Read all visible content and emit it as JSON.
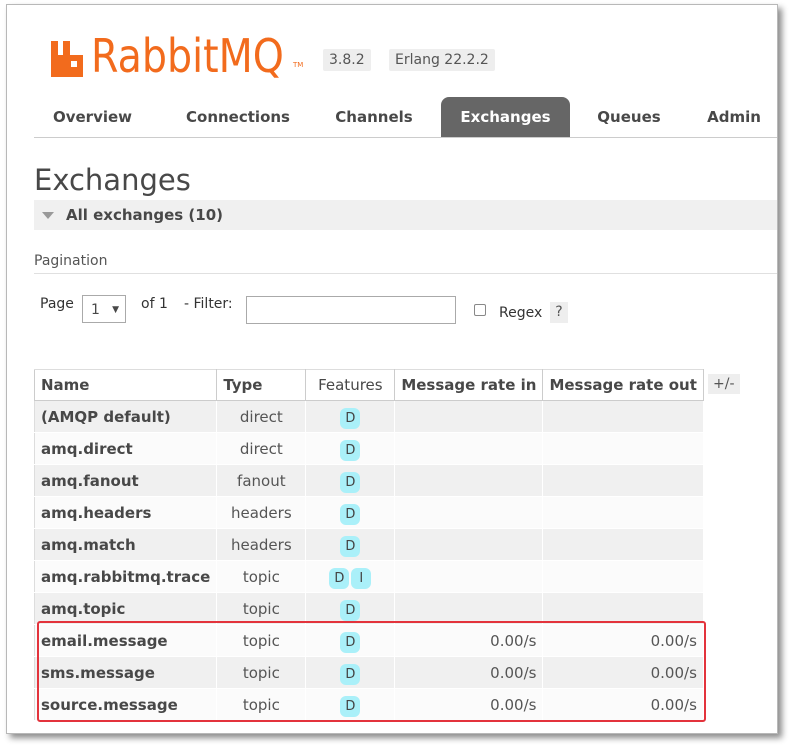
{
  "app": {
    "logo_text": "RabbitMQ",
    "logo_tm": "TM",
    "version": "3.8.2",
    "erlang": "Erlang 22.2.2",
    "brand_color": "#f26b1d"
  },
  "tabs": [
    {
      "label": "Overview"
    },
    {
      "label": "Connections"
    },
    {
      "label": "Channels"
    },
    {
      "label": "Exchanges",
      "active": true
    },
    {
      "label": "Queues"
    },
    {
      "label": "Admin"
    }
  ],
  "page_title": "Exchanges",
  "section_title": "All exchanges (10)",
  "pagination": {
    "label": "Pagination",
    "page_label": "Page",
    "page_value": "1",
    "of_label": "of 1",
    "filter_label": "- Filter:",
    "filter_value": "",
    "regex_label": "Regex",
    "help": "?"
  },
  "table": {
    "columns": [
      "Name",
      "Type",
      "Features",
      "Message rate in",
      "Message rate out"
    ],
    "toggle_columns": "+/-",
    "rows": [
      {
        "name": "(AMQP default)",
        "type": "direct",
        "features": [
          "D"
        ],
        "rate_in": "",
        "rate_out": ""
      },
      {
        "name": "amq.direct",
        "type": "direct",
        "features": [
          "D"
        ],
        "rate_in": "",
        "rate_out": ""
      },
      {
        "name": "amq.fanout",
        "type": "fanout",
        "features": [
          "D"
        ],
        "rate_in": "",
        "rate_out": ""
      },
      {
        "name": "amq.headers",
        "type": "headers",
        "features": [
          "D"
        ],
        "rate_in": "",
        "rate_out": ""
      },
      {
        "name": "amq.match",
        "type": "headers",
        "features": [
          "D"
        ],
        "rate_in": "",
        "rate_out": ""
      },
      {
        "name": "amq.rabbitmq.trace",
        "type": "topic",
        "features": [
          "D",
          "I"
        ],
        "rate_in": "",
        "rate_out": ""
      },
      {
        "name": "amq.topic",
        "type": "topic",
        "features": [
          "D"
        ],
        "rate_in": "",
        "rate_out": ""
      },
      {
        "name": "email.message",
        "type": "topic",
        "features": [
          "D"
        ],
        "rate_in": "0.00/s",
        "rate_out": "0.00/s"
      },
      {
        "name": "sms.message",
        "type": "topic",
        "features": [
          "D"
        ],
        "rate_in": "0.00/s",
        "rate_out": "0.00/s"
      },
      {
        "name": "source.message",
        "type": "topic",
        "features": [
          "D"
        ],
        "rate_in": "0.00/s",
        "rate_out": "0.00/s"
      }
    ]
  },
  "colors": {
    "active_tab": "#666666",
    "badge": "#aaf0f9",
    "highlight": "#e3333c"
  }
}
